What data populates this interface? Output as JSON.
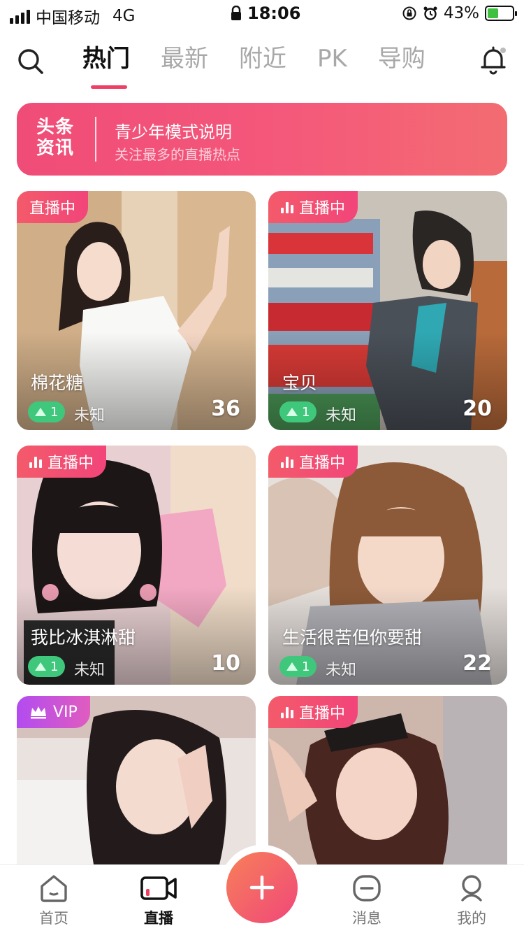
{
  "status_bar": {
    "carrier": "中国移动",
    "network": "4G",
    "time": "18:06",
    "battery_percent": "43%",
    "battery_level": 0.43
  },
  "top_nav": {
    "tabs": [
      {
        "label": "热门",
        "active": true
      },
      {
        "label": "最新",
        "active": false
      },
      {
        "label": "附近",
        "active": false
      },
      {
        "label": "PK",
        "active": false
      },
      {
        "label": "导购",
        "active": false
      }
    ]
  },
  "banner": {
    "logo_line1": "头条",
    "logo_line2": "资讯",
    "title": "青少年模式说明",
    "subtitle": "关注最多的直播热点"
  },
  "cards": [
    {
      "badge": "直播中",
      "badge_type": "live",
      "name": "棉花糖",
      "level": "1",
      "location": "未知",
      "count": "36"
    },
    {
      "badge": "直播中",
      "badge_type": "live",
      "name": "宝贝",
      "level": "1",
      "location": "未知",
      "count": "20"
    },
    {
      "badge": "直播中",
      "badge_type": "live",
      "name": "我比冰淇淋甜",
      "level": "1",
      "location": "未知",
      "count": "10"
    },
    {
      "badge": "直播中",
      "badge_type": "live",
      "name": "生活很苦但你要甜",
      "level": "1",
      "location": "未知",
      "count": "22"
    },
    {
      "badge": "VIP",
      "badge_type": "vip",
      "name": "",
      "level": "",
      "location": "",
      "count": ""
    },
    {
      "badge": "直播中",
      "badge_type": "live",
      "name": "",
      "level": "",
      "location": "",
      "count": ""
    }
  ],
  "bottom_nav": {
    "items": [
      {
        "label": "首页",
        "icon": "home-icon",
        "active": false
      },
      {
        "label": "直播",
        "icon": "video-camera-icon",
        "active": true
      },
      {
        "label": "消息",
        "icon": "message-icon",
        "active": false
      },
      {
        "label": "我的",
        "icon": "profile-icon",
        "active": false
      }
    ],
    "center_icon": "plus-icon"
  },
  "colors": {
    "accent": "#ee3f64",
    "badge_live": "#f2457a",
    "badge_vip": "#b24cf0",
    "level_green": "#3fc77c"
  }
}
